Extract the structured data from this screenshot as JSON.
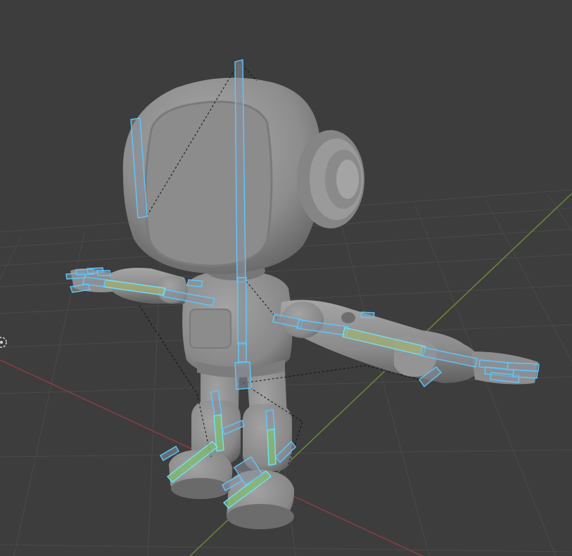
{
  "viewport": {
    "background": "#3d3d3d",
    "grid_color": "#4a4a4a",
    "x_axis_color": "#8a3f45",
    "y_axis_color": "#6b8a36",
    "bone_outline_color": "#5cc8ff",
    "model_color": "#8e8e8e"
  },
  "scene": {
    "object": "robot-character-mesh",
    "armature": "robot-armature",
    "mode": "pose",
    "cursor_icon": "3d-cursor-icon"
  }
}
